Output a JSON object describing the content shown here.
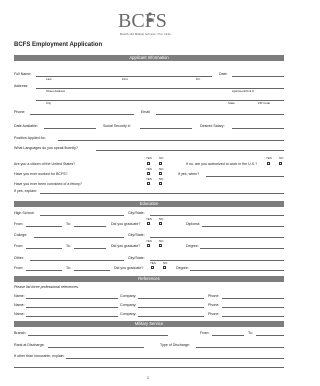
{
  "logo": {
    "brand": "BCFS",
    "tagline": "Health and Human Services • Est. 1944"
  },
  "title": "BCFS Employment Application",
  "sections": {
    "applicant": "Applicant Information",
    "education": "Education",
    "references": "References",
    "military": "Military Service"
  },
  "applicant": {
    "full_name": "Full Name:",
    "date": "Date:",
    "last": "Last",
    "first": "First",
    "mi": "M.I.",
    "address": "Address:",
    "street": "Street Address",
    "apt": "Apartment/Unit #",
    "city": "City",
    "state": "State",
    "zip": "ZIP Code",
    "phone": "Phone:",
    "email": "Email",
    "date_available": "Date Available:",
    "ssn": "Social Security #:",
    "desired_salary": "Desired Salary:",
    "position": "Position Applied for:",
    "languages": "What Languages do you speak fluently?",
    "yes": "YES",
    "no": "NO",
    "citizen": "Are you a citizen of the United States?",
    "authorized": "If no, are you authorized to work in the U.S.?",
    "worked": "Have you ever worked for BCFS?",
    "when": "If yes, when?",
    "felony": "Have you ever been convicted of a felony?",
    "explain": "If yes, explain:"
  },
  "education": {
    "high_school": "High School:",
    "city_state": "City/State:",
    "from": "From:",
    "to": "To:",
    "graduate": "Did you graduate?",
    "diploma": "Diploma:",
    "college": "College:",
    "degree": "Degree:",
    "other": "Other:"
  },
  "references": {
    "intro": "Please list three professional references.",
    "name": "Name:",
    "company": "Company:",
    "phone": "Phone:"
  },
  "military": {
    "branch": "Branch:",
    "from": "From:",
    "to": "To:",
    "rank": "Rank at Discharge:",
    "type": "Type of Discharge:",
    "other": "If other than honorable, explain:"
  },
  "page_number": "1",
  "colors": {
    "brand": "#6a6a6a",
    "section_bar": "#7d7d7d"
  }
}
